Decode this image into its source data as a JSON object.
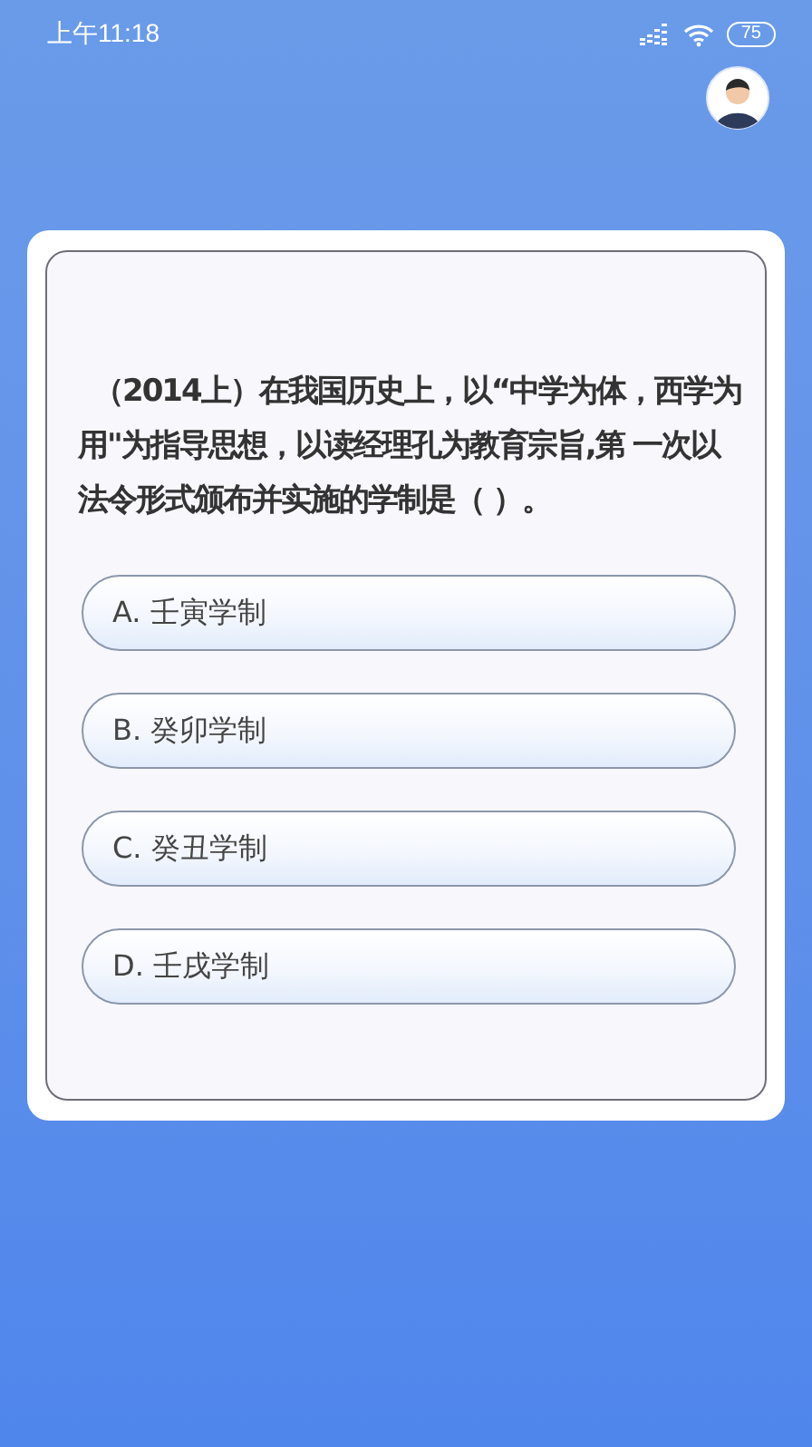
{
  "status_bar": {
    "time": "上午11:18",
    "battery": "75"
  },
  "question": {
    "text": "（2014上）在我国历史上，以“中学为体，西学为用\"为指导思想，以读经理孔为教育宗旨,第 一次以法令形式颁布并实施的学制是（ ）。"
  },
  "options": [
    {
      "label": "A. 壬寅学制"
    },
    {
      "label": "B. 癸卯学制"
    },
    {
      "label": "C. 癸丑学制"
    },
    {
      "label": "D. 壬戌学制"
    }
  ]
}
